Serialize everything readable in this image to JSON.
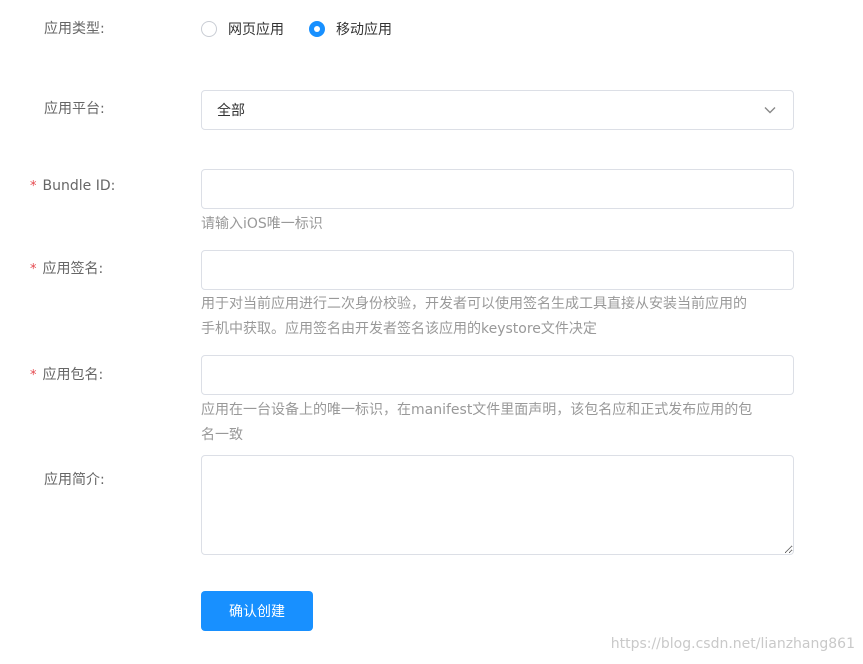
{
  "form": {
    "app_type": {
      "label": "应用类型:",
      "options": [
        {
          "label": "网页应用",
          "checked": false
        },
        {
          "label": "移动应用",
          "checked": true
        }
      ]
    },
    "platform": {
      "label": "应用平台:",
      "value": "全部"
    },
    "bundle_id": {
      "required_mark": "*",
      "label": "Bundle ID:",
      "value": "",
      "help": "请输入iOS唯一标识"
    },
    "signature": {
      "required_mark": "*",
      "label": "应用签名:",
      "value": "",
      "help_line1": "用于对当前应用进行二次身份校验，开发者可以使用签名生成工具直接从安装当前应用的",
      "help_line2": "手机中获取。应用签名由开发者签名该应用的keystore文件决定"
    },
    "package": {
      "required_mark": "*",
      "label": "应用包名:",
      "value": "",
      "help_line1": "应用在一台设备上的唯一标识，在manifest文件里面声明，该包名应和正式发布应用的包",
      "help_line2": "名一致"
    },
    "description": {
      "label": "应用简介:",
      "value": ""
    },
    "submit_label": "确认创建"
  },
  "watermark": "https://blog.csdn.net/lianzhang861",
  "colors": {
    "primary": "#1890ff",
    "required": "#e5484d",
    "help_text": "#999999",
    "label_text": "#666666"
  },
  "icons": {
    "select_arrow": "chevron-down-icon"
  }
}
